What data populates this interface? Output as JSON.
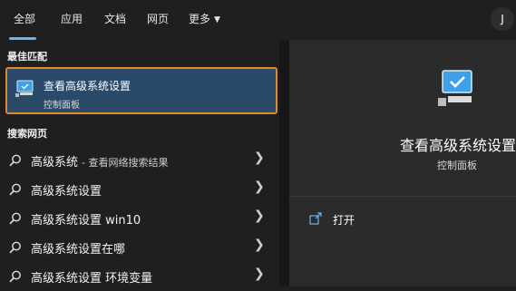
{
  "tabs": [
    {
      "label": "全部",
      "active": true
    },
    {
      "label": "应用"
    },
    {
      "label": "文档"
    },
    {
      "label": "网页"
    },
    {
      "label": "更多"
    }
  ],
  "avatar": {
    "initial": "J"
  },
  "best_match": {
    "section_label": "最佳匹配",
    "title": "查看高级系统设置",
    "subtitle": "控制面板",
    "icon": "monitor-check-icon"
  },
  "web_search": {
    "section_label": "搜索网页",
    "items": [
      {
        "label": "高级系统",
        "suffix": "- 查看网络搜索结果"
      },
      {
        "label": "高级系统设置",
        "suffix": ""
      },
      {
        "label": "高级系统设置 win10",
        "suffix": ""
      },
      {
        "label": "高级系统设置在哪",
        "suffix": ""
      },
      {
        "label": "高级系统设置 环境变量",
        "suffix": ""
      }
    ]
  },
  "preview": {
    "title": "查看高级系统设置",
    "subtitle": "控制面板",
    "open_label": "打开"
  },
  "colors": {
    "accent": "#6cb4f0",
    "selection_bg": "#2a4a6a",
    "selection_border": "#e08a2a",
    "panel_bg": "#1f1f1f",
    "preview_bg": "#2b2b2b"
  }
}
